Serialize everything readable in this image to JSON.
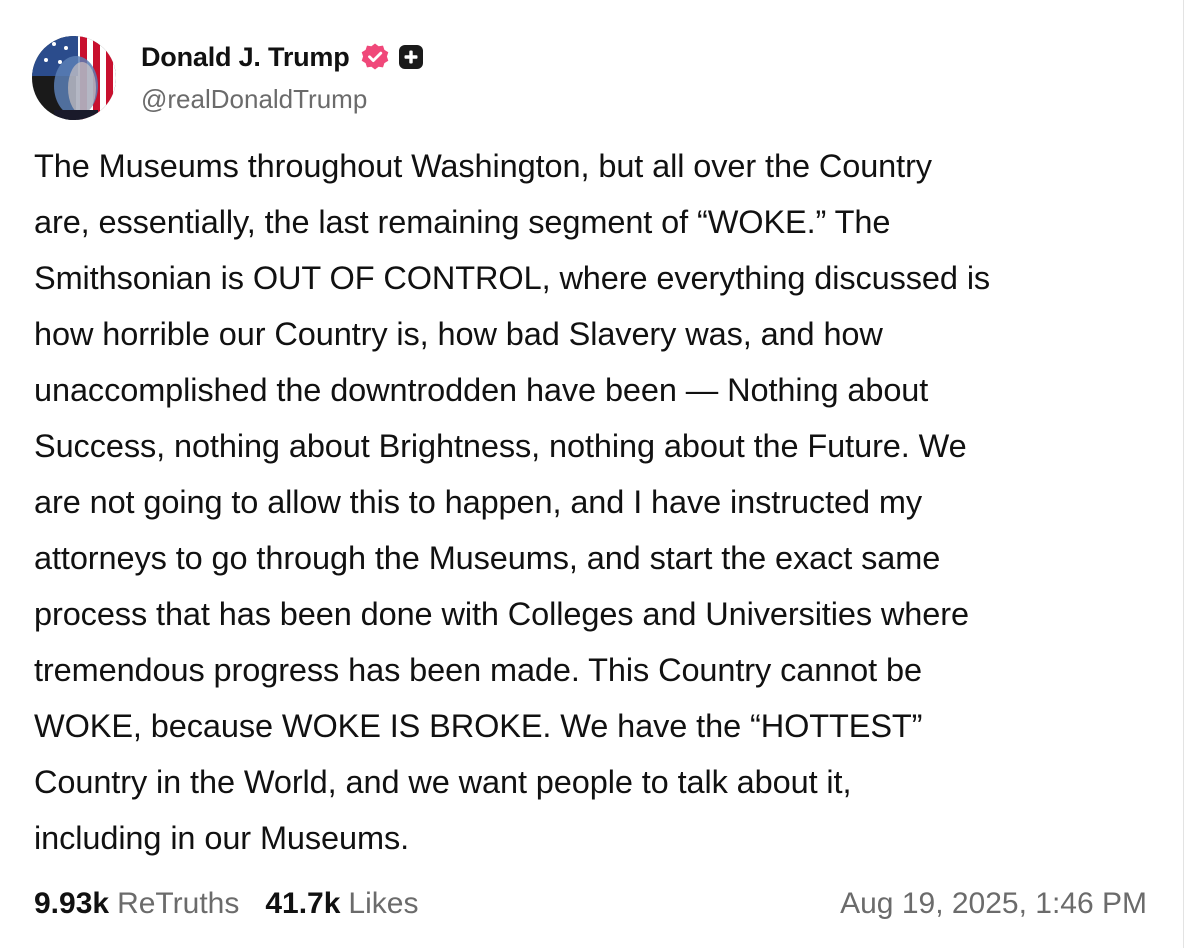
{
  "author": {
    "display_name": "Donald J. Trump",
    "handle": "@realDonaldTrump",
    "verified_icon": "verified-badge-icon",
    "plus_icon": "plus-square-icon",
    "badge_color": "#f0487a"
  },
  "post": {
    "lines": [
      "The Museums throughout Washington, but all over the Country",
      "are, essentially, the last remaining segment of “WOKE.” The",
      "Smithsonian is OUT OF CONTROL, where everything discussed is",
      "how horrible our Country is, how bad Slavery was, and how",
      "unaccomplished the downtrodden have been — Nothing about",
      "Success, nothing about Brightness, nothing about the Future. We",
      "are not going to allow this to happen, and I have instructed my",
      "attorneys to go through the Museums, and start the exact same",
      "process that has been done with Colleges and Universities where",
      "tremendous progress has been made. This Country cannot be",
      "WOKE, because WOKE IS BROKE. We have the “HOTTEST”",
      "Country in the World, and we want people to talk about it,",
      "including in our Museums."
    ]
  },
  "stats": {
    "retruths_count": "9.93k",
    "retruths_label": "ReTruths",
    "likes_count": "41.7k",
    "likes_label": "Likes"
  },
  "timestamp": "Aug 19, 2025, 1:46 PM"
}
